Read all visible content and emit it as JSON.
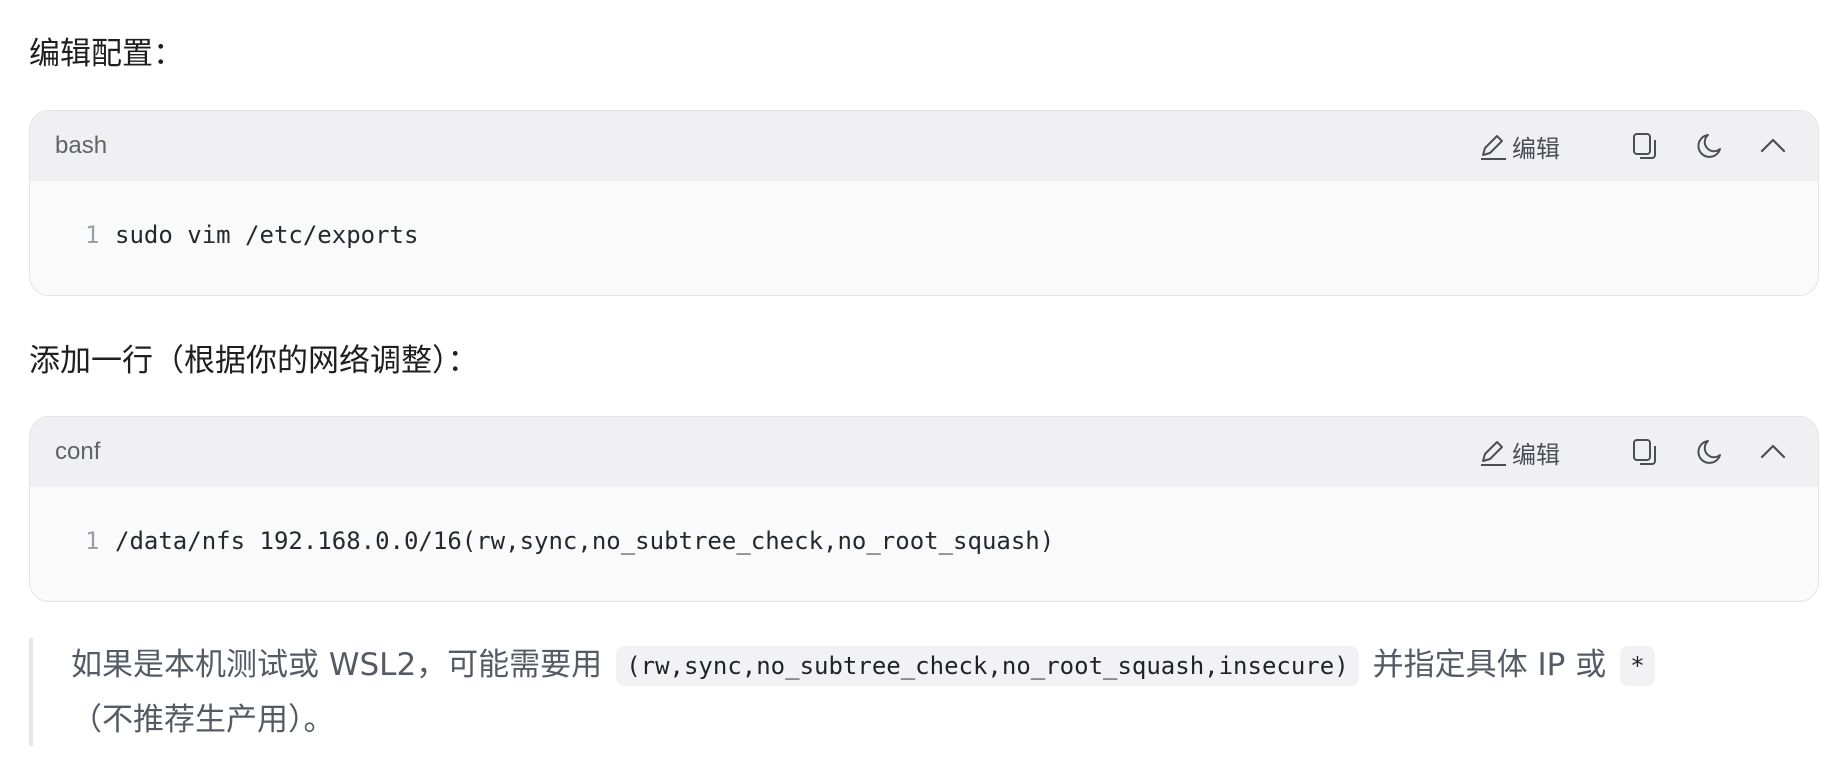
{
  "intro_text": "编辑配置：",
  "mid_text": "添加一行（根据你的网络调整）：",
  "code_blocks": [
    {
      "lang": "bash",
      "edit_label": "编辑",
      "line_number": "1",
      "code": "sudo vim /etc/exports"
    },
    {
      "lang": "conf",
      "edit_label": "编辑",
      "line_number": "1",
      "code": "/data/nfs 192.168.0.0/16(rw,sync,no_subtree_check,no_root_squash)"
    }
  ],
  "note": {
    "part1": "如果是本机测试或 WSL2，可能需要用",
    "code1": "(rw,sync,no_subtree_check,no_root_squash,insecure)",
    "part2": "并指定具体 IP 或",
    "code2": "*",
    "part3": "（不推荐生产用）。"
  },
  "icons": {
    "edit": "pencil-icon",
    "copy": "copy-icon",
    "theme": "moon-icon",
    "collapse": "chevron-up-icon"
  }
}
